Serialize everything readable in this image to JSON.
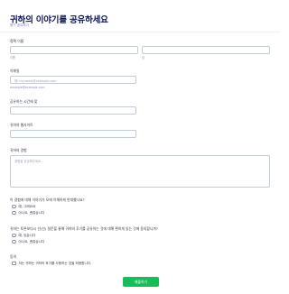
{
  "header": {
    "title": "귀하의 이야기를 공유하세요",
    "subtitle": "용기 공유하기"
  },
  "form": {
    "name": {
      "label": "정확 이름",
      "first_sub": "이름",
      "last_sub": "성"
    },
    "email": {
      "label": "이메일",
      "placeholder": "예: myname@example.com",
      "sub": "example@example.com"
    },
    "date": {
      "label": "공유하는 시간에 맞"
    },
    "phone": {
      "label": "귀하의 웹사이트"
    },
    "story": {
      "label": "귀하의 경험",
      "placeholder": "경험을 공유해주세요..."
    },
    "q1": {
      "label": "이 경험에 대해 이야기가 모에 이해하게 반대했나요?",
      "options": [
        "예, 그래요요",
        "아니요, 괜찮습니다"
      ]
    },
    "q2": {
      "label": "귀하는 토론보다시 선(선) 질문을 통해 귀하의 후기를 공유하는 것에 대해 편하게 있는 것에 동의합니까?",
      "options": [
        "예, 있습니다",
        "아니요, 괜찮습니다"
      ]
    },
    "consent": {
      "label": "동의",
      "option": "저는 귀하는 귀하의 후기를 사용하는 것을 허용합니다."
    },
    "submit_label": "제출하기"
  }
}
